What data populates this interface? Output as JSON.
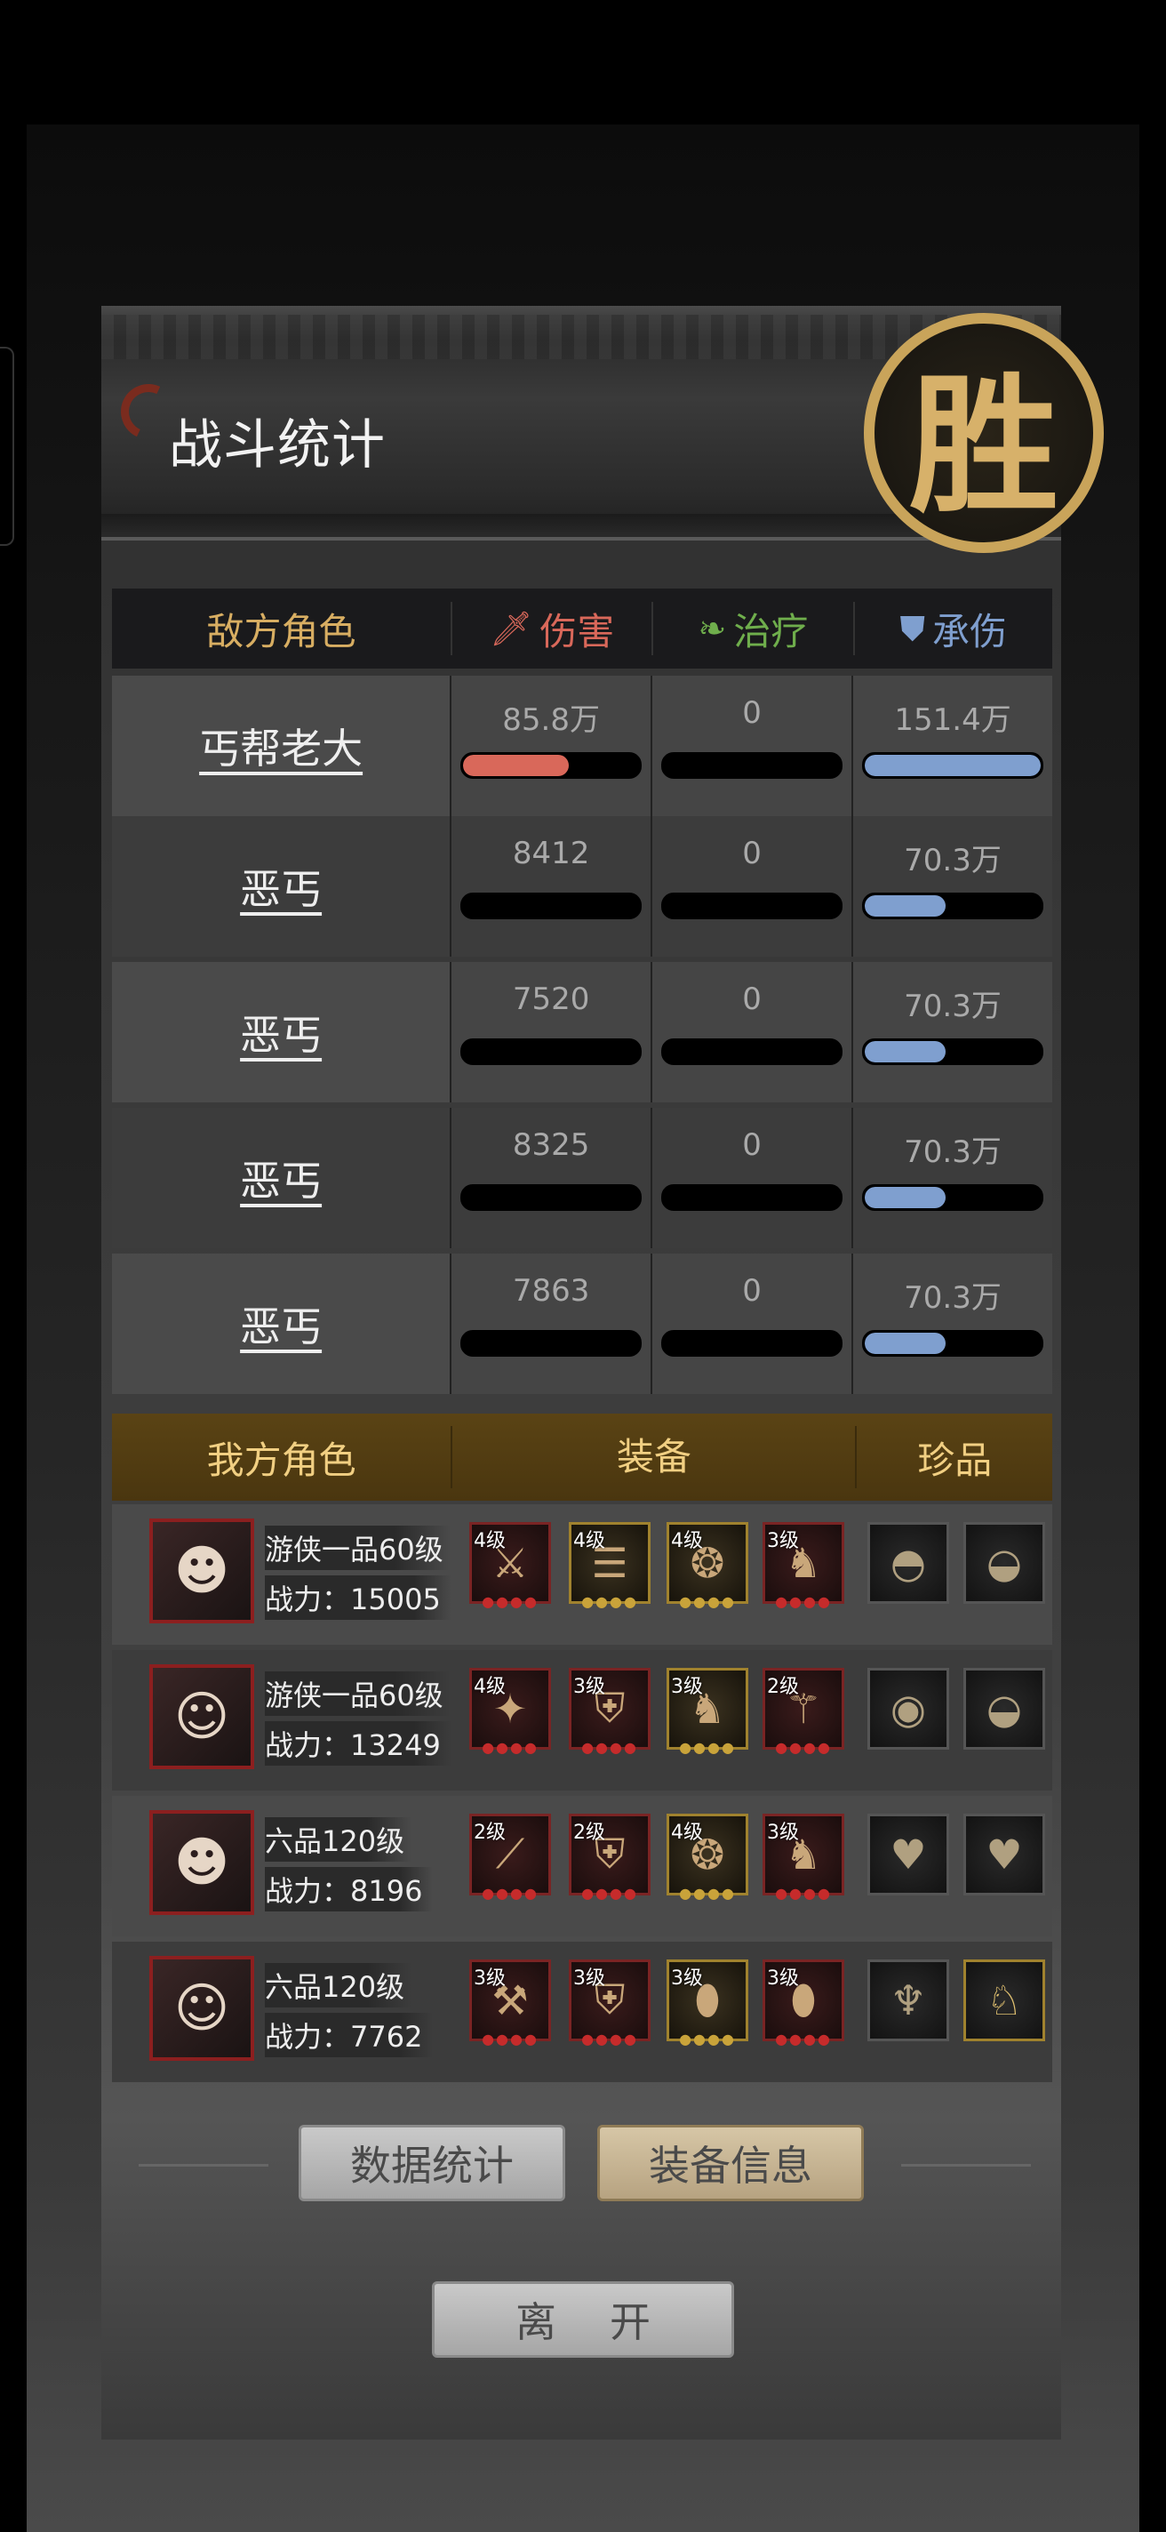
{
  "header": {
    "title": "战斗统计",
    "seal": "胜"
  },
  "enemy_table": {
    "headers": {
      "role": "敌方角色",
      "damage": "伤害",
      "heal": "治疗",
      "taken": "承伤"
    },
    "rows": [
      {
        "name": "丐帮老大",
        "damage": "85.8万",
        "heal": "0",
        "taken": "151.4万",
        "damage_fill": 0.6,
        "heal_fill": 0,
        "taken_fill": 1.0
      },
      {
        "name": "恶丐",
        "damage": "8412",
        "heal": "0",
        "taken": "70.3万",
        "damage_fill": 0,
        "heal_fill": 0,
        "taken_fill": 0.46
      },
      {
        "name": "恶丐",
        "damage": "7520",
        "heal": "0",
        "taken": "70.3万",
        "damage_fill": 0,
        "heal_fill": 0,
        "taken_fill": 0.46
      },
      {
        "name": "恶丐",
        "damage": "8325",
        "heal": "0",
        "taken": "70.3万",
        "damage_fill": 0,
        "heal_fill": 0,
        "taken_fill": 0.46
      },
      {
        "name": "恶丐",
        "damage": "7863",
        "heal": "0",
        "taken": "70.3万",
        "damage_fill": 0,
        "heal_fill": 0,
        "taken_fill": 0.46
      }
    ]
  },
  "ally_table": {
    "headers": {
      "role": "我方角色",
      "equip": "装备",
      "treasure": "珍品"
    },
    "rows": [
      {
        "level": "游侠一品60级",
        "power": "战力：15005",
        "equip": [
          {
            "lvl": "4级",
            "icon": "⚔",
            "gold": false
          },
          {
            "lvl": "4级",
            "icon": "☰",
            "gold": true
          },
          {
            "lvl": "4级",
            "icon": "❂",
            "gold": true
          },
          {
            "lvl": "3级",
            "icon": "♞",
            "gold": false
          }
        ],
        "treasures": [
          {
            "icon": "◓",
            "gold": false
          },
          {
            "icon": "◒",
            "gold": false
          }
        ]
      },
      {
        "level": "游侠一品60级",
        "power": "战力：13249",
        "equip": [
          {
            "lvl": "4级",
            "icon": "✦",
            "gold": false
          },
          {
            "lvl": "3级",
            "icon": "⛨",
            "gold": false
          },
          {
            "lvl": "3级",
            "icon": "♞",
            "gold": true
          },
          {
            "lvl": "2级",
            "icon": "⚚",
            "gold": false
          }
        ],
        "treasures": [
          {
            "icon": "◉",
            "gold": false
          },
          {
            "icon": "◒",
            "gold": false
          }
        ]
      },
      {
        "level": "六品120级",
        "power": "战力：8196",
        "equip": [
          {
            "lvl": "2级",
            "icon": "⟋",
            "gold": false
          },
          {
            "lvl": "2级",
            "icon": "⛨",
            "gold": false
          },
          {
            "lvl": "4级",
            "icon": "❂",
            "gold": true
          },
          {
            "lvl": "3级",
            "icon": "♞",
            "gold": false
          }
        ],
        "treasures": [
          {
            "icon": "♥",
            "gold": false
          },
          {
            "icon": "♥",
            "gold": false
          }
        ]
      },
      {
        "level": "六品120级",
        "power": "战力：7762",
        "equip": [
          {
            "lvl": "3级",
            "icon": "⚒",
            "gold": false
          },
          {
            "lvl": "3级",
            "icon": "⛨",
            "gold": false
          },
          {
            "lvl": "3级",
            "icon": "⬮",
            "gold": true
          },
          {
            "lvl": "3级",
            "icon": "⬮",
            "gold": false
          }
        ],
        "treasures": [
          {
            "icon": "♆",
            "gold": false
          },
          {
            "icon": "♘",
            "gold": true
          }
        ]
      }
    ]
  },
  "buttons": {
    "stats": "数据统计",
    "equip_info": "装备信息",
    "leave": "离开"
  },
  "colors": {
    "damage": "#d9685a",
    "heal": "#6fae4c",
    "taken": "#7f9fcf",
    "gold": "#d8ae62"
  }
}
